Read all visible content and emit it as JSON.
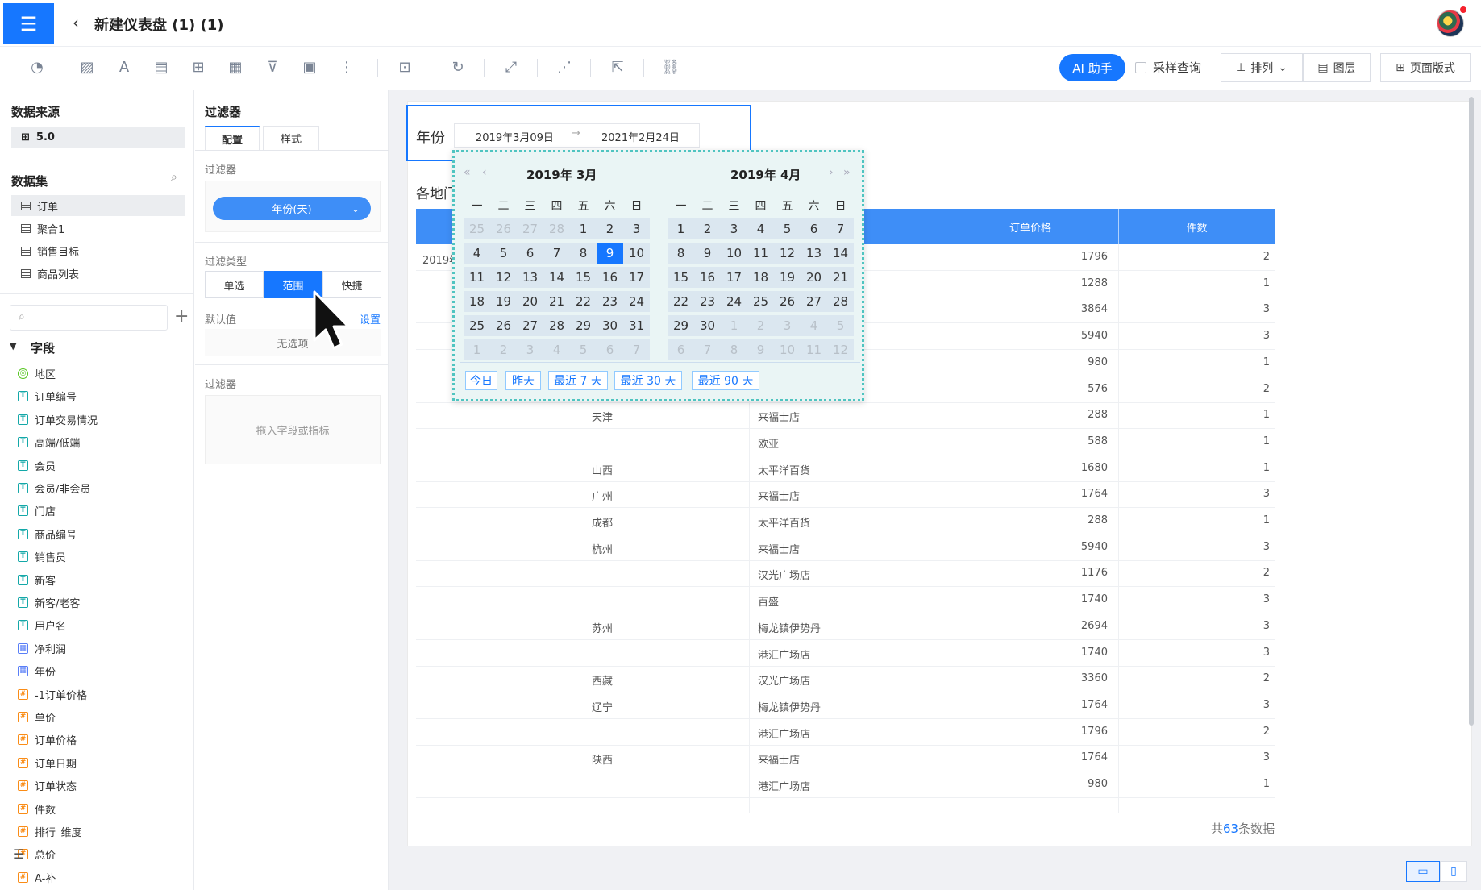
{
  "header": {
    "title": "新建仪表盘 (1) (1)"
  },
  "toolbar": {
    "ai_label": "AI 助手",
    "sample_label": "采样查询",
    "arrange_label": "排列",
    "layer_label": "图层",
    "layout_label": "页面版式"
  },
  "left": {
    "datasource_title": "数据来源",
    "datasource_value": "5.0",
    "dataset_title": "数据集",
    "datasets": [
      "订单",
      "聚合1",
      "销售目标",
      "商品列表"
    ],
    "fields_title": "字段",
    "fields": [
      {
        "name": "地区",
        "type": "g"
      },
      {
        "name": "订单编号",
        "type": "t"
      },
      {
        "name": "订单交易情况",
        "type": "t"
      },
      {
        "name": "高端/低端",
        "type": "t"
      },
      {
        "name": "会员",
        "type": "t"
      },
      {
        "name": "会员/非会员",
        "type": "t"
      },
      {
        "name": "门店",
        "type": "t"
      },
      {
        "name": "商品编号",
        "type": "t"
      },
      {
        "name": "销售员",
        "type": "t"
      },
      {
        "name": "新客",
        "type": "t"
      },
      {
        "name": "新客/老客",
        "type": "t"
      },
      {
        "name": "用户名",
        "type": "t"
      },
      {
        "name": "净利润",
        "type": "d"
      },
      {
        "name": "年份",
        "type": "d"
      },
      {
        "name": "-1订单价格",
        "type": "n"
      },
      {
        "name": "单价",
        "type": "n"
      },
      {
        "name": "订单价格",
        "type": "n"
      },
      {
        "name": "订单日期",
        "type": "n"
      },
      {
        "name": "订单状态",
        "type": "n"
      },
      {
        "name": "件数",
        "type": "n"
      },
      {
        "name": "排行_维度",
        "type": "n"
      },
      {
        "name": "总价",
        "type": "n"
      },
      {
        "name": "A-补",
        "type": "n"
      }
    ]
  },
  "mid": {
    "title": "过滤器",
    "tab_config": "配置",
    "tab_style": "样式",
    "filter_label": "过滤器",
    "filter_pill": "年份(天)",
    "type_label": "过滤类型",
    "seg": [
      "单选",
      "范围",
      "快捷"
    ],
    "default_label": "默认值",
    "set_label": "设置",
    "no_option": "无选项",
    "filter_label2": "过滤器",
    "drop_hint": "拖入字段或指标"
  },
  "canvas": {
    "filter_title": "年份",
    "date_start": "2019年3月09日",
    "date_end": "2021年2月24日",
    "chart_title": "各地门",
    "col_price": "订单价格",
    "col_count": "件数",
    "first_year": "2019年",
    "rows": [
      {
        "region": "",
        "store": "",
        "price": "1796",
        "count": "2"
      },
      {
        "region": "",
        "store": "",
        "price": "1288",
        "count": "1"
      },
      {
        "region": "",
        "store": "",
        "price": "3864",
        "count": "3"
      },
      {
        "region": "",
        "store": "",
        "price": "5940",
        "count": "3"
      },
      {
        "region": "",
        "store": "",
        "price": "980",
        "count": "1"
      },
      {
        "region": "",
        "store": "",
        "price": "576",
        "count": "2"
      },
      {
        "region": "天津",
        "store": "来福士店",
        "price": "288",
        "count": "1"
      },
      {
        "region": "",
        "store": "欧亚",
        "price": "588",
        "count": "1"
      },
      {
        "region": "山西",
        "store": "太平洋百货",
        "price": "1680",
        "count": "1"
      },
      {
        "region": "广州",
        "store": "来福士店",
        "price": "1764",
        "count": "3"
      },
      {
        "region": "成都",
        "store": "太平洋百货",
        "price": "288",
        "count": "1"
      },
      {
        "region": "杭州",
        "store": "来福士店",
        "price": "5940",
        "count": "3"
      },
      {
        "region": "",
        "store": "汉光广场店",
        "price": "1176",
        "count": "2"
      },
      {
        "region": "",
        "store": "百盛",
        "price": "1740",
        "count": "3"
      },
      {
        "region": "苏州",
        "store": "梅龙镇伊势丹",
        "price": "2694",
        "count": "3"
      },
      {
        "region": "",
        "store": "港汇广场店",
        "price": "1740",
        "count": "3"
      },
      {
        "region": "西藏",
        "store": "汉光广场店",
        "price": "3360",
        "count": "2"
      },
      {
        "region": "辽宁",
        "store": "梅龙镇伊势丹",
        "price": "1764",
        "count": "3"
      },
      {
        "region": "",
        "store": "港汇广场店",
        "price": "1796",
        "count": "2"
      },
      {
        "region": "陕西",
        "store": "来福士店",
        "price": "1764",
        "count": "3"
      },
      {
        "region": "",
        "store": "港汇广场店",
        "price": "980",
        "count": "1"
      }
    ],
    "total_prefix": "共",
    "total_count": "63",
    "total_suffix": "条数据"
  },
  "calendar": {
    "left_title": "2019年 3月",
    "right_title": "2019年 4月",
    "weekdays": [
      "一",
      "二",
      "三",
      "四",
      "五",
      "六",
      "日"
    ],
    "left_days": [
      "25",
      "26",
      "27",
      "28",
      "1",
      "2",
      "3",
      "4",
      "5",
      "6",
      "7",
      "8",
      "9",
      "10",
      "11",
      "12",
      "13",
      "14",
      "15",
      "16",
      "17",
      "18",
      "19",
      "20",
      "21",
      "22",
      "23",
      "24",
      "25",
      "26",
      "27",
      "28",
      "29",
      "30",
      "31",
      "1",
      "2",
      "3",
      "4",
      "5",
      "6",
      "7"
    ],
    "right_days": [
      "1",
      "2",
      "3",
      "4",
      "5",
      "6",
      "7",
      "8",
      "9",
      "10",
      "11",
      "12",
      "13",
      "14",
      "15",
      "16",
      "17",
      "18",
      "19",
      "20",
      "21",
      "22",
      "23",
      "24",
      "25",
      "26",
      "27",
      "28",
      "29",
      "30",
      "1",
      "2",
      "3",
      "4",
      "5",
      "6",
      "7",
      "8",
      "9",
      "10",
      "11",
      "12"
    ],
    "quick": [
      "今日",
      "昨天",
      "最近 7 天",
      "最近 30 天",
      "最近 90 天"
    ]
  }
}
